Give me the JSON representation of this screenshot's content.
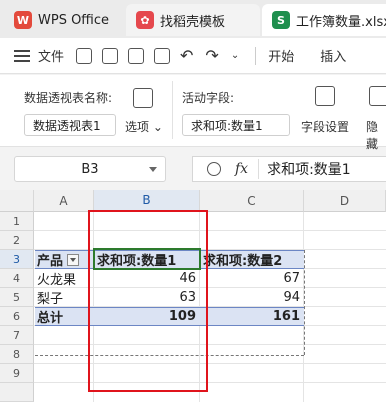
{
  "tabs": [
    {
      "label": "WPS Office",
      "icon": "wps-logo-icon"
    },
    {
      "label": "找稻壳模板",
      "icon": "docer-icon"
    },
    {
      "label": "工作簿数量.xlsx",
      "icon": "spreadsheet-icon",
      "icon_text": "S"
    }
  ],
  "menu": {
    "file_label": "文件",
    "start_label": "开始",
    "insert_label": "插入"
  },
  "ribbon": {
    "pivot_name_label": "数据透视表名称:",
    "pivot_name_value": "数据透视表1",
    "options_label": "选项",
    "active_field_label": "活动字段:",
    "active_field_value": "求和项:数量1",
    "field_settings_label": "字段设置",
    "hide_label": "隐藏"
  },
  "formula_bar": {
    "cell_ref": "B3",
    "fx_label": "fx",
    "content": "求和项:数量1"
  },
  "grid": {
    "columns": [
      "A",
      "B",
      "C",
      "D"
    ],
    "rows": [
      "1",
      "2",
      "3",
      "4",
      "5",
      "6",
      "7",
      "8",
      "9"
    ],
    "selected_column": "B",
    "selected_row": "3",
    "header": {
      "a": "产品",
      "b": "求和项:数量1",
      "c": "求和项:数量2"
    },
    "data_rows": [
      {
        "a": "火龙果",
        "b": "46",
        "c": "67"
      },
      {
        "a": "梨子",
        "b": "63",
        "c": "94"
      }
    ],
    "total": {
      "a": "总计",
      "b": "109",
      "c": "161"
    }
  },
  "colors": {
    "accent": "#2f6fc5",
    "highlight_box": "#e0141c",
    "active_cell": "#2d7a2d",
    "pivot_fill": "#dbe3f3"
  }
}
